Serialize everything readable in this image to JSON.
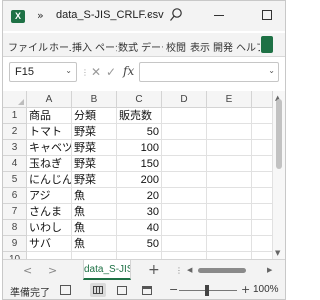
{
  "window": {
    "app_icon": "excel-icon",
    "app_icon_glyph": "X",
    "title_chevron": "»",
    "title": "data_S-JIS_CRLF.csv",
    "title_dropdown": "⌄",
    "search_icon": "search-icon",
    "minimize_icon": "minimize-icon",
    "maximize_icon": "maximize-icon"
  },
  "ribbon": {
    "tabs": [
      "ファイル",
      "ホーム",
      "挿入",
      "ページ",
      "数式",
      "データ",
      "校閲",
      "表示",
      "開発",
      "ヘルプ"
    ]
  },
  "formula_bar": {
    "name_box": "F15",
    "name_dropdown": "⌄",
    "more": "⋮",
    "cancel": "✕",
    "enter": "✓",
    "fx": "fx",
    "content": "",
    "expand": "⌄"
  },
  "columns": [
    "A",
    "B",
    "C",
    "D",
    "E"
  ],
  "rows": [
    {
      "num": "1",
      "cells": [
        "商品",
        "分類",
        "販売数",
        "",
        ""
      ]
    },
    {
      "num": "2",
      "cells": [
        "トマト",
        "野菜",
        "50",
        "",
        ""
      ]
    },
    {
      "num": "3",
      "cells": [
        "キャベツ",
        "野菜",
        "100",
        "",
        ""
      ]
    },
    {
      "num": "4",
      "cells": [
        "玉ねぎ",
        "野菜",
        "150",
        "",
        ""
      ]
    },
    {
      "num": "5",
      "cells": [
        "にんじん",
        "野菜",
        "200",
        "",
        ""
      ]
    },
    {
      "num": "6",
      "cells": [
        "アジ",
        "魚",
        "20",
        "",
        ""
      ]
    },
    {
      "num": "7",
      "cells": [
        "さんま",
        "魚",
        "30",
        "",
        ""
      ]
    },
    {
      "num": "8",
      "cells": [
        "いわし",
        "魚",
        "40",
        "",
        ""
      ]
    },
    {
      "num": "9",
      "cells": [
        "サバ",
        "魚",
        "50",
        "",
        ""
      ]
    },
    {
      "num": "10",
      "cells": [
        "",
        "",
        "",
        "",
        ""
      ]
    }
  ],
  "sheets": {
    "prev": "<",
    "next": ">",
    "active": "data_S-JIS_CRLF",
    "add": "+",
    "more": "⋮",
    "scroll_left": "◀",
    "scroll_right": "▶"
  },
  "status": {
    "ready": "準備完了",
    "zoom_minus": "−",
    "zoom_plus": "+",
    "zoom": "100%"
  },
  "colors": {
    "accent": "#1e7145"
  }
}
